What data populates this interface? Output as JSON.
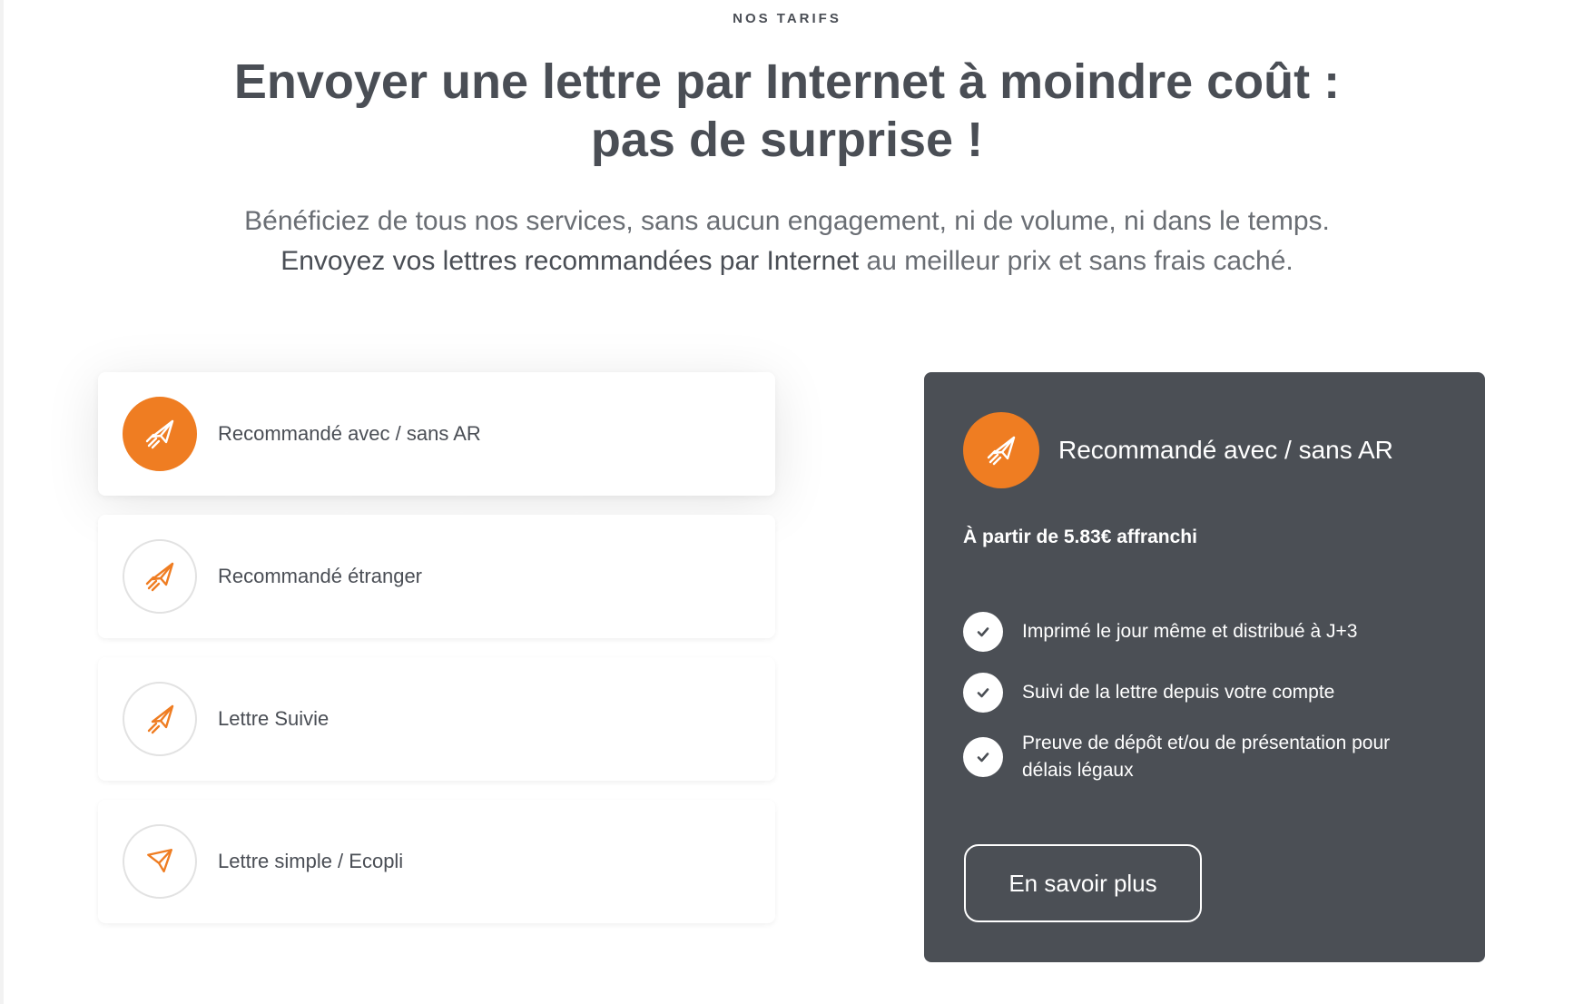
{
  "section": {
    "eyebrow": "NOS TARIFS",
    "title_line1": "Envoyer une lettre par Internet à moindre coût :",
    "title_line2": "pas de surprise !",
    "subtitle_line1": "Bénéficiez de tous nos services, sans aucun engagement, ni de volume, ni dans le temps.",
    "subtitle_line2_strong": "Envoyez vos lettres recommandées par Internet",
    "subtitle_line2_rest": " au meilleur prix et sans frais caché."
  },
  "options": [
    {
      "label": "Recommandé avec / sans AR",
      "active": true,
      "icon": "rocket-icon"
    },
    {
      "label": "Recommandé étranger",
      "active": false,
      "icon": "rocket-icon"
    },
    {
      "label": "Lettre Suivie",
      "active": false,
      "icon": "rocket-icon"
    },
    {
      "label": "Lettre simple / Ecopli",
      "active": false,
      "icon": "paper-plane-icon"
    }
  ],
  "detail": {
    "title": "Recommandé avec / sans AR",
    "price": "À partir de 5.83€ affranchi",
    "features": [
      "Imprimé le jour même et distribué à J+3",
      "Suivi de la lettre depuis votre compte",
      "Preuve de dépôt et/ou de présentation pour délais légaux"
    ],
    "cta_label": "En savoir plus"
  },
  "colors": {
    "accent": "#ef7d22",
    "panel_bg": "#4b4f55",
    "text": "#4a4e55"
  }
}
